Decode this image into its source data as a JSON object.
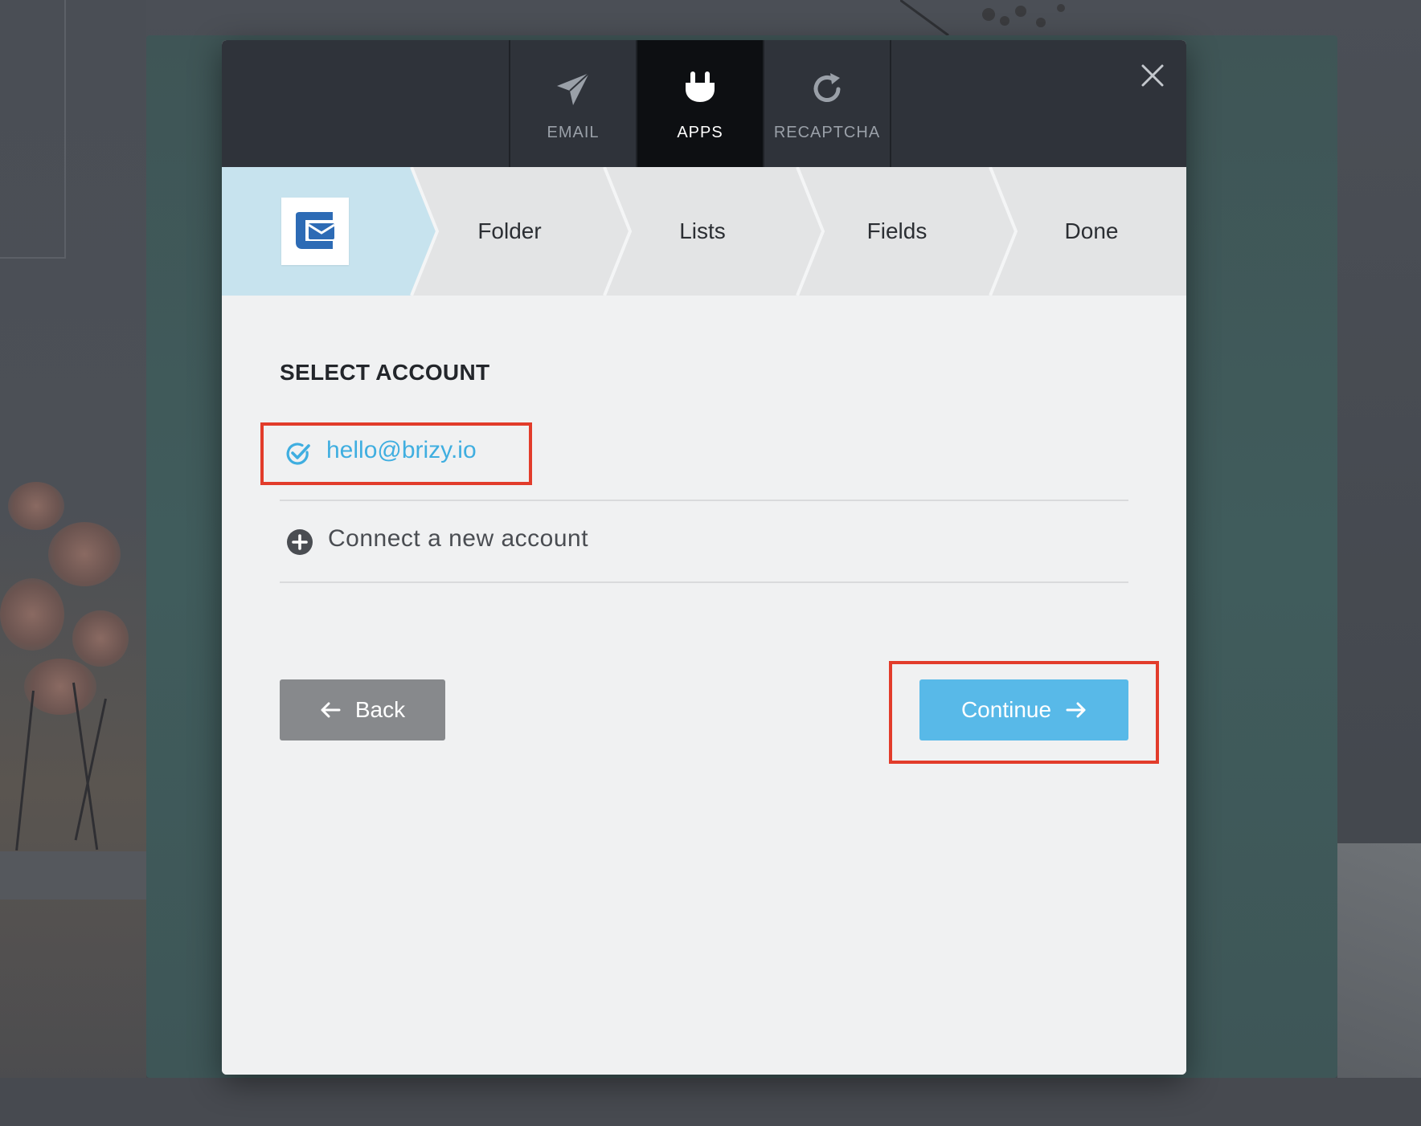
{
  "tabs": [
    {
      "label": "EMAIL",
      "icon": "paper-plane-icon",
      "active": false
    },
    {
      "label": "APPS",
      "icon": "plug-icon",
      "active": true
    },
    {
      "label": "RECAPTCHA",
      "icon": "refresh-icon",
      "active": false
    }
  ],
  "stepper": {
    "logo_icon": "email-service-logo-icon",
    "steps": [
      "Folder",
      "Lists",
      "Fields",
      "Done"
    ]
  },
  "content": {
    "section_title": "SELECT ACCOUNT",
    "account": {
      "email": "hello@brizy.io",
      "status_icon": "check-circle-icon"
    },
    "connect_label": "Connect a new account",
    "back_label": "Back",
    "continue_label": "Continue"
  },
  "colors": {
    "accent": "#58b9e8",
    "link": "#3faee0",
    "highlight": "#e23c2b",
    "topbar": "#2f333a",
    "active_tab": "#0d0f12"
  }
}
